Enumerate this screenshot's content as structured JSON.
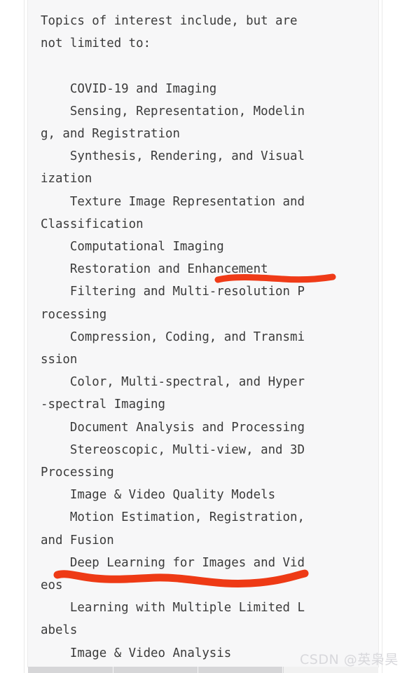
{
  "document": {
    "block_kind": "code-block",
    "intro_lines": [
      "Topics of interest include, but are",
      "not limited to:"
    ],
    "blank_line": "",
    "topic_lines": [
      "    COVID-19 and Imaging",
      "    Sensing, Representation, Modelin",
      "g, and Registration",
      "    Synthesis, Rendering, and Visual",
      "ization",
      "    Texture Image Representation and",
      "Classification",
      "    Computational Imaging",
      "    Restoration and Enhancement",
      "    Filtering and Multi-resolution P",
      "rocessing",
      "    Compression, Coding, and Transmi",
      "ssion",
      "    Color, Multi-spectral, and Hyper",
      "-spectral Imaging",
      "    Document Analysis and Processing",
      "    Stereoscopic, Multi-view, and 3D",
      "Processing",
      "    Image & Video Quality Models",
      "    Motion Estimation, Registration,",
      "and Fusion",
      "    Deep Learning for Images and Vid",
      "eos",
      "    Learning with Multiple Limited L",
      "abels",
      "    Image & Video Analysis"
    ],
    "full_text": "Topics of interest include, but are\nnot limited to:\n\n    COVID-19 and Imaging\n    Sensing, Representation, Modelin\ng, and Registration\n    Synthesis, Rendering, and Visual\nization\n    Texture Image Representation and\nClassification\n    Computational Imaging\n    Restoration and Enhancement\n    Filtering and Multi-resolution P\nrocessing\n    Compression, Coding, and Transmi\nssion\n    Color, Multi-spectral, and Hyper\n-spectral Imaging\n    Document Analysis and Processing\n    Stereoscopic, Multi-view, and 3D\nProcessing\n    Image & Video Quality Models\n    Motion Estimation, Registration,\nand Fusion\n    Deep Learning for Images and Vid\neos\n    Learning with Multiple Limited L\nabels\n    Image & Video Analysis"
  },
  "annotations": [
    {
      "id": "underline-restoration-enhancement",
      "kind": "hand-drawn-underline",
      "color": "#ef3b18",
      "targets_text": "Restoration and Enhancement"
    },
    {
      "id": "underline-deep-learning",
      "kind": "hand-drawn-underline",
      "color": "#ee3a15",
      "targets_text": "Deep Learning for Images and Videos"
    }
  ],
  "watermark": {
    "text": "CSDN @英枭昊"
  },
  "scrollbar": {
    "orientation": "horizontal"
  },
  "colors": {
    "code_background": "#f7f7f8",
    "page_background": "#ffffff",
    "text": "#3b3b3b",
    "annotation_red": "#ef3b18",
    "watermark": "#d8d8dc",
    "scrollbar_thumb": "#d6d6d8",
    "scrollbar_track": "#f1f1f1"
  }
}
